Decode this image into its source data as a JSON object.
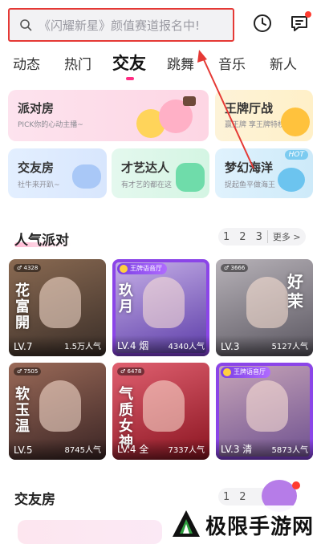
{
  "search": {
    "placeholder": "《闪耀新星》颜值赛道报名中!"
  },
  "top_icons": [
    "clock-icon",
    "message-icon"
  ],
  "tabs": [
    {
      "label": "动态",
      "active": false
    },
    {
      "label": "热门",
      "active": false
    },
    {
      "label": "交友",
      "active": true
    },
    {
      "label": "跳舞",
      "active": false
    },
    {
      "label": "音乐",
      "active": false
    },
    {
      "label": "新人",
      "active": false
    }
  ],
  "categories": [
    {
      "title": "派对房",
      "subtitle": "PICK你的心动主播~"
    },
    {
      "title": "王牌厅战",
      "subtitle": "赢王牌 享王牌特权"
    },
    {
      "title": "交友房",
      "subtitle": "社牛来开趴~"
    },
    {
      "title": "才艺达人",
      "subtitle": "有才艺的都在这"
    },
    {
      "title": "梦幻海洋",
      "subtitle": "捉起鱼平做海王",
      "badge": "HOT"
    }
  ],
  "popular_party": {
    "title": "人气派对",
    "pager": {
      "pages": [
        "1",
        "2",
        "3"
      ],
      "more": "更多 >"
    },
    "rooms": [
      {
        "level": "LV.7",
        "popularity": "1.5万人气",
        "id_badge": "♂ 4328",
        "deco": "花富開",
        "colors": [
          "#3a2e28",
          "#8a6a52"
        ]
      },
      {
        "level": "LV.4 烟",
        "popularity": "4340人气",
        "gold_badge": "王牌语音厅",
        "deco": "玖月",
        "colors": [
          "#5a3aa8",
          "#c9b3e8"
        ]
      },
      {
        "level": "LV.3",
        "popularity": "5127人气",
        "id_badge": "♂ 3666",
        "deco": "",
        "colors": [
          "#5a5660",
          "#b7b2b8"
        ]
      },
      {
        "level": "LV.3",
        "popularity": "",
        "id_badge": "",
        "deco": "好茉",
        "colors": [
          "#6f8a70",
          "#d8e3d2"
        ]
      },
      {
        "level": "LV.5",
        "popularity": "8745人气",
        "id_badge": "♂ 7505",
        "deco": "软玉温",
        "colors": [
          "#3a2424",
          "#9a6a58"
        ]
      },
      {
        "level": "LV.4 全",
        "popularity": "7337人气",
        "id_badge": "♂ 6478",
        "deco": "气质女神",
        "colors": [
          "#8a1420",
          "#e06070"
        ]
      },
      {
        "level": "LV.3 清",
        "popularity": "5873人气",
        "gold_badge": "王牌语音厅",
        "deco": "",
        "colors": [
          "#6d4f8f",
          "#c9a7b9"
        ]
      }
    ]
  },
  "friends_section": {
    "title": "交友房",
    "pager": {
      "pages": [
        "1",
        "2"
      ]
    }
  },
  "watermark": {
    "text": "极限手游网"
  },
  "colors": {
    "accent": "#ff2d83",
    "highlight_box": "#e53935",
    "frame": "#8b45e8"
  }
}
